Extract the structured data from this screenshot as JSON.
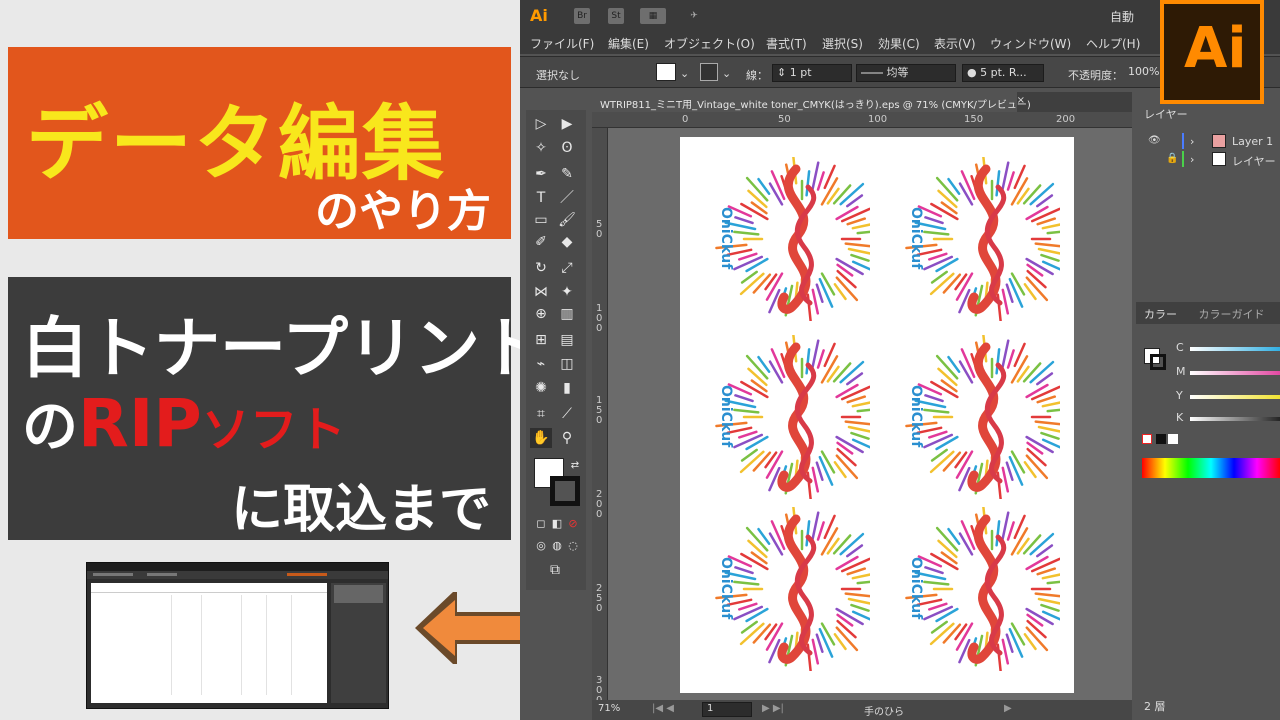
{
  "promo": {
    "title_line1": "データ編集",
    "title_line2": "のやり方",
    "subtitle_line1": "白トナープリント",
    "subtitle_line2_prefix": "の",
    "subtitle_line2_rip": "RIP",
    "subtitle_line2_soft": "ソフト",
    "subtitle_line3": "に取込まで"
  },
  "colors": {
    "orange": "#e2561c",
    "yellow": "#f8e71c",
    "dark_panel": "#3c3c3c",
    "red": "#e31c1c",
    "arrow": "#f08a3c",
    "ai_orange": "#ff8a00"
  },
  "app": {
    "logo_small": "Ai",
    "logo_big": "Ai",
    "top_icons": [
      "Br",
      "St"
    ],
    "auto_select": "自動",
    "menu": [
      "ファイル(F)",
      "編集(E)",
      "オブジェクト(O)",
      "書式(T)",
      "選択(S)",
      "効果(C)",
      "表示(V)",
      "ウィンドウ(W)",
      "ヘルプ(H)"
    ],
    "control": {
      "selection": "選択なし",
      "stroke_label": "線：",
      "stroke_value": "1 pt",
      "line_style": "均等",
      "brush": "5 pt. R...",
      "opacity_label": "不透明度：",
      "opacity_value": "100%"
    },
    "doc_tab": "WTRIP811_ミニT用_Vintage_white toner_CMYK(はっきり).eps @ 71% (CMYK/プレビュー)",
    "doc_tab_close": "×",
    "ruler_h": [
      "0",
      "50",
      "100",
      "150",
      "200"
    ],
    "ruler_v": [
      "5\n0",
      "1\n0\n0",
      "1\n5\n0",
      "2\n0\n0",
      "2\n5\n0",
      "3\n0\n0"
    ],
    "status": {
      "zoom": "71%",
      "page": "1",
      "tool": "手のひら"
    },
    "layers_panel": {
      "title": "レイヤー",
      "layers": [
        "Layer 1",
        "レイヤー"
      ],
      "count": "2 層"
    },
    "color_panel": {
      "tab_color": "カラー",
      "tab_guide": "カラーガイド",
      "channels": [
        {
          "label": "C",
          "value": "0",
          "color": "#1fa8e0"
        },
        {
          "label": "M",
          "value": "0",
          "color": "#e0389a"
        },
        {
          "label": "Y",
          "value": "0",
          "color": "#f0e020"
        },
        {
          "label": "K",
          "value": "0",
          "color": "#d0d0d0"
        }
      ]
    },
    "artwork_text": "OniCkuf"
  }
}
